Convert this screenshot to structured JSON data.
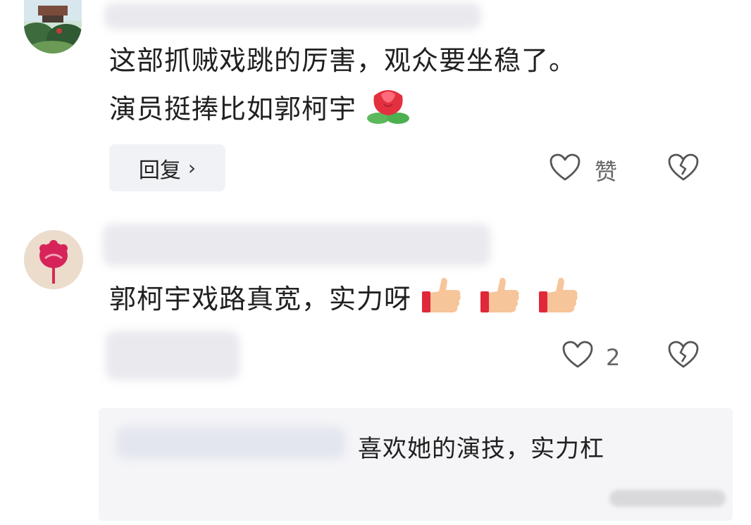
{
  "comments": [
    {
      "text_line1": "这部抓贼戏跳的厉害，观众要坐稳了。",
      "text_line2": "演员挺捧比如郭柯宇",
      "emoji": "rose-icon",
      "reply_label": "回复",
      "like_label": "赞"
    },
    {
      "text": "郭柯宇戏路真宽，实力呀",
      "emoji": "thumbs-up-icon",
      "emoji_count": 3,
      "like_count": "2"
    }
  ],
  "sub_reply": {
    "text": "喜欢她的演技，实力杠"
  },
  "colors": {
    "background": "#ffffff",
    "reply_bg": "#f1f2f5",
    "icon_gray": "#555555",
    "rose_red": "#e2303f",
    "thumb_skin": "#f6c59a",
    "cuff_red": "#e0283a"
  }
}
